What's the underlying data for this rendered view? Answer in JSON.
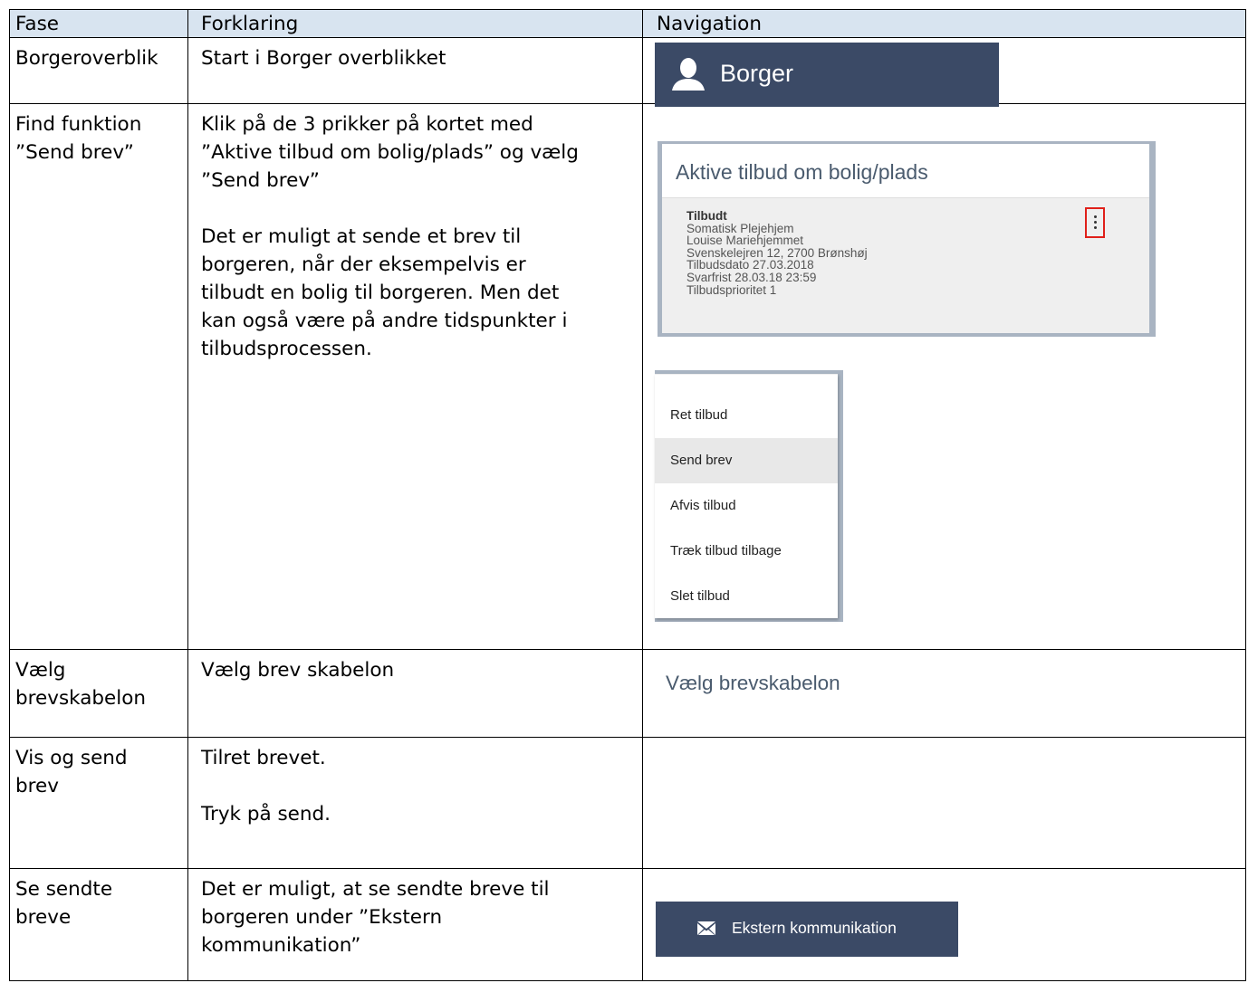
{
  "table": {
    "headers": [
      "Fase",
      "Forklaring",
      "Navigation"
    ],
    "rows": [
      {
        "fase": [
          "Borgeroverblik"
        ],
        "forklaring": [
          "Start i Borger overblikket"
        ]
      },
      {
        "fase": [
          "Find funktion",
          "”Send brev”"
        ],
        "forklaring_p1": [
          "Klik på de 3 prikker på kortet med",
          "”Aktive tilbud om bolig/plads” og vælg",
          "”Send brev”"
        ],
        "forklaring_p2": [
          "Det er muligt at sende et brev til",
          "borgeren, når der eksempelvis er",
          "tilbudt en bolig til borgeren. Men det",
          "kan også være på andre tidspunkter i",
          "tilbudsprocessen."
        ]
      },
      {
        "fase": [
          "Vælg",
          "brevskabelon"
        ],
        "forklaring": [
          "Vælg brev skabelon"
        ]
      },
      {
        "fase": [
          "Vis og send",
          "brev"
        ],
        "forklaring_p1": [
          "Tilret brevet."
        ],
        "forklaring_p2": [
          "Tryk på send."
        ]
      },
      {
        "fase": [
          "Se sendte",
          "breve"
        ],
        "forklaring": [
          "Det er muligt, at se sendte breve til",
          "borgeren under ”Ekstern",
          "kommunikation”"
        ]
      }
    ]
  },
  "nav": {
    "borger_label": "Borger",
    "card": {
      "title": "Aktive tilbud om bolig/plads",
      "lines": [
        "Tilbudt",
        "Somatisk Plejehjem",
        "Louise Mariehjemmet",
        "Svenskelejren 12, 2700 Brønshøj",
        "Tilbudsdato 27.03.2018",
        "Svarfrist 28.03.18 23:59",
        "Tilbudsprioritet 1"
      ]
    },
    "menu": [
      "Ret tilbud",
      "Send brev",
      "Afvis tilbud",
      "Træk tilbud tilbage",
      "Slet tilbud"
    ],
    "menu_active_index": 1,
    "skabelon_label": "Vælg brevskabelon",
    "ekstern_label": "Ekstern kommunikation"
  },
  "colors": {
    "header_bg": "#D8E4F0",
    "nav_bar": "#3b4a66",
    "highlight": "#e0201a"
  }
}
